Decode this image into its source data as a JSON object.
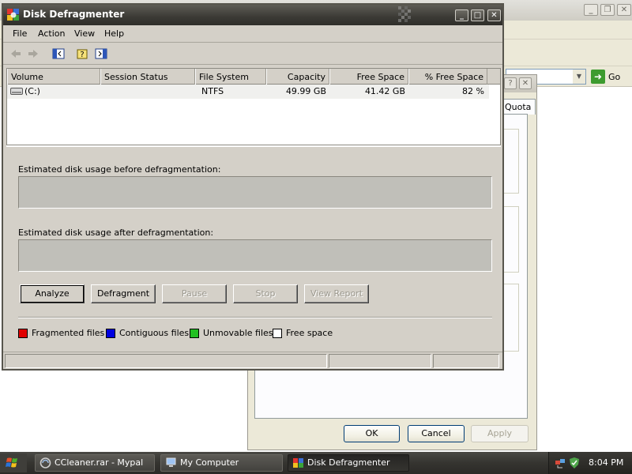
{
  "defrag": {
    "title": "Disk Defragmenter",
    "menu": [
      "File",
      "Action",
      "View",
      "Help"
    ],
    "columns": [
      "Volume",
      "Session Status",
      "File System",
      "Capacity",
      "Free Space",
      "% Free Space"
    ],
    "volume": {
      "name": "(C:)",
      "session_status": "",
      "file_system": "NTFS",
      "capacity": "49.99 GB",
      "free_space": "41.42 GB",
      "percent_free": "82 %"
    },
    "before_label": "Estimated disk usage before defragmentation:",
    "after_label": "Estimated disk usage after defragmentation:",
    "buttons": {
      "analyze": "Analyze",
      "defragment": "Defragment",
      "pause": "Pause",
      "stop": "Stop",
      "view_report": "View Report"
    },
    "legend": [
      {
        "label": "Fragmented files",
        "color": "#e00000"
      },
      {
        "label": "Contiguous files",
        "color": "#0000e0"
      },
      {
        "label": "Unmovable files",
        "color": "#22c022"
      },
      {
        "label": "Free space",
        "color": "#ffffff"
      }
    ]
  },
  "explorer": {
    "go_label": "Go"
  },
  "properties_dialog": {
    "tab_label": "Quota",
    "ok_label": "OK",
    "cancel_label": "Cancel",
    "apply_label": "Apply"
  },
  "taskbar": {
    "items": [
      {
        "label": "CCleaner.rar - Mypal",
        "active": false
      },
      {
        "label": "My Computer",
        "active": false
      },
      {
        "label": "Disk Defragmenter",
        "active": true
      }
    ],
    "clock": "8:04 PM"
  }
}
